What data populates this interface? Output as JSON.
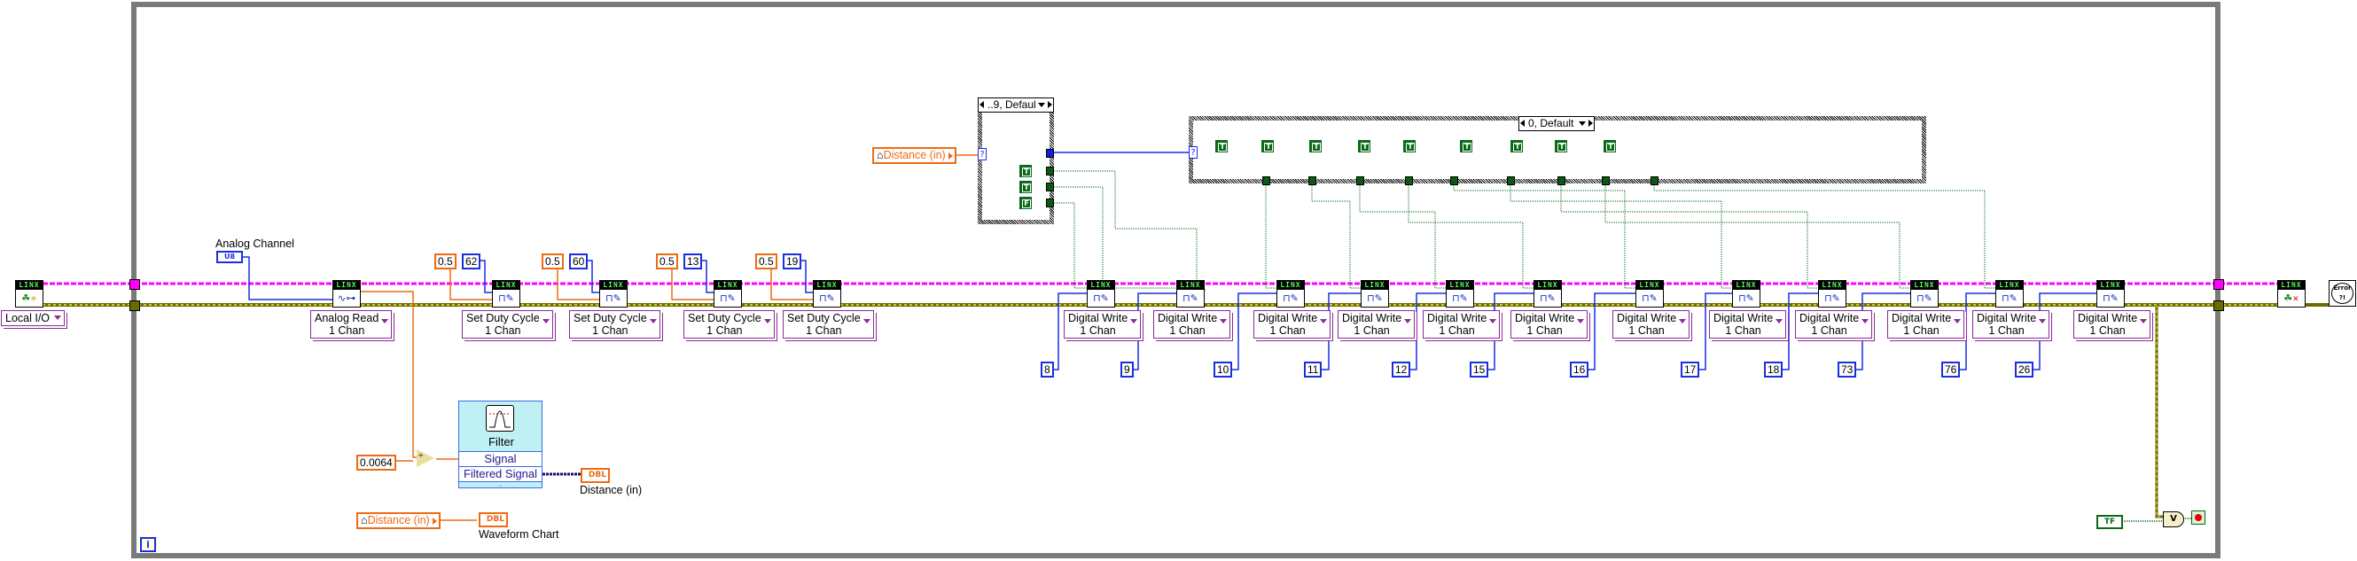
{
  "diagram": {
    "type": "LabVIEW block diagram",
    "while_loop": {
      "iteration_terminal": "i"
    },
    "open": {
      "header": "LINX",
      "icon": "linx-open-icon",
      "resource": "Local I/O"
    },
    "close": {
      "header": "LINX",
      "icon": "linx-close-icon"
    },
    "error_handler": {
      "icon": "simple-error-handler-icon",
      "text": "Error ?!"
    },
    "analog_channel": {
      "label": "Analog Channel",
      "type": "U8"
    },
    "analog_read": {
      "header": "LINX",
      "label_line1": "Analog Read",
      "label_line2": "1 Chan"
    },
    "pwm_blocks": [
      {
        "header": "LINX",
        "duty": "0.5",
        "channel": "62",
        "label_line1": "Set Duty Cycle",
        "label_line2": "1 Chan"
      },
      {
        "header": "LINX",
        "duty": "0.5",
        "channel": "60",
        "label_line1": "Set Duty Cycle",
        "label_line2": "1 Chan"
      },
      {
        "header": "LINX",
        "duty": "0.5",
        "channel": "13",
        "label_line1": "Set Duty Cycle",
        "label_line2": "1 Chan"
      },
      {
        "header": "LINX",
        "duty": "0.5",
        "channel": "19",
        "label_line1": "Set Duty Cycle",
        "label_line2": "1 Chan"
      }
    ],
    "digital_writes": [
      {
        "header": "LINX",
        "channel": "8",
        "label_line1": "Digital Write",
        "label_line2": "1 Chan"
      },
      {
        "header": "LINX",
        "channel": "9",
        "label_line1": "Digital Write",
        "label_line2": "1 Chan"
      },
      {
        "header": "LINX",
        "channel": "10",
        "label_line1": "Digital Write",
        "label_line2": "1 Chan"
      },
      {
        "header": "LINX",
        "channel": "11",
        "label_line1": "Digital Write",
        "label_line2": "1 Chan"
      },
      {
        "header": "LINX",
        "channel": "12",
        "label_line1": "Digital Write",
        "label_line2": "1 Chan"
      },
      {
        "header": "LINX",
        "channel": "15",
        "label_line1": "Digital Write",
        "label_line2": "1 Chan"
      },
      {
        "header": "LINX",
        "channel": "16",
        "label_line1": "Digital Write",
        "label_line2": "1 Chan"
      },
      {
        "header": "LINX",
        "channel": "17",
        "label_line1": "Digital Write",
        "label_line2": "1 Chan"
      },
      {
        "header": "LINX",
        "channel": "18",
        "label_line1": "Digital Write",
        "label_line2": "1 Chan"
      },
      {
        "header": "LINX",
        "channel": "73",
        "label_line1": "Digital Write",
        "label_line2": "1 Chan"
      },
      {
        "header": "LINX",
        "channel": "76",
        "label_line1": "Digital Write",
        "label_line2": "1 Chan"
      },
      {
        "header": "LINX",
        "channel": "26",
        "label_line1": "Digital Write",
        "label_line2": "1 Chan"
      }
    ],
    "case_structure_1": {
      "selector_label": "..9, Defaul",
      "selector_terminal": "?",
      "constants": [
        "T",
        "T",
        "F"
      ]
    },
    "case_structure_2": {
      "selector_label": "0, Default",
      "selector_terminal": "?",
      "constants": [
        "T",
        "T",
        "T",
        "T",
        "T",
        "T",
        "T",
        "T",
        "T"
      ]
    },
    "distance_local_1": {
      "label": "Distance (in)"
    },
    "distance_local_2": {
      "label": "Distance (in)"
    },
    "divide_constant": "0.0064",
    "divide_symbol": "÷",
    "filter": {
      "title": "Filter",
      "input": "Signal",
      "output": "Filtered Signal"
    },
    "distance_indicator": {
      "type": "DBL",
      "label": "Distance (in)"
    },
    "waveform_chart": {
      "type": "DBL",
      "label": "Waveform Chart"
    },
    "stop_control": {
      "text": "TF"
    },
    "or_symbol": "V",
    "colors": {
      "loop_border": "#7a7a7a",
      "linx_resource_wire": "#ff00ff",
      "error_wire": "#6b6b00",
      "dbl_wire": "#f06a14",
      "int_wire": "#1a2ee0",
      "bool_wire": "#0a6a1a"
    }
  }
}
